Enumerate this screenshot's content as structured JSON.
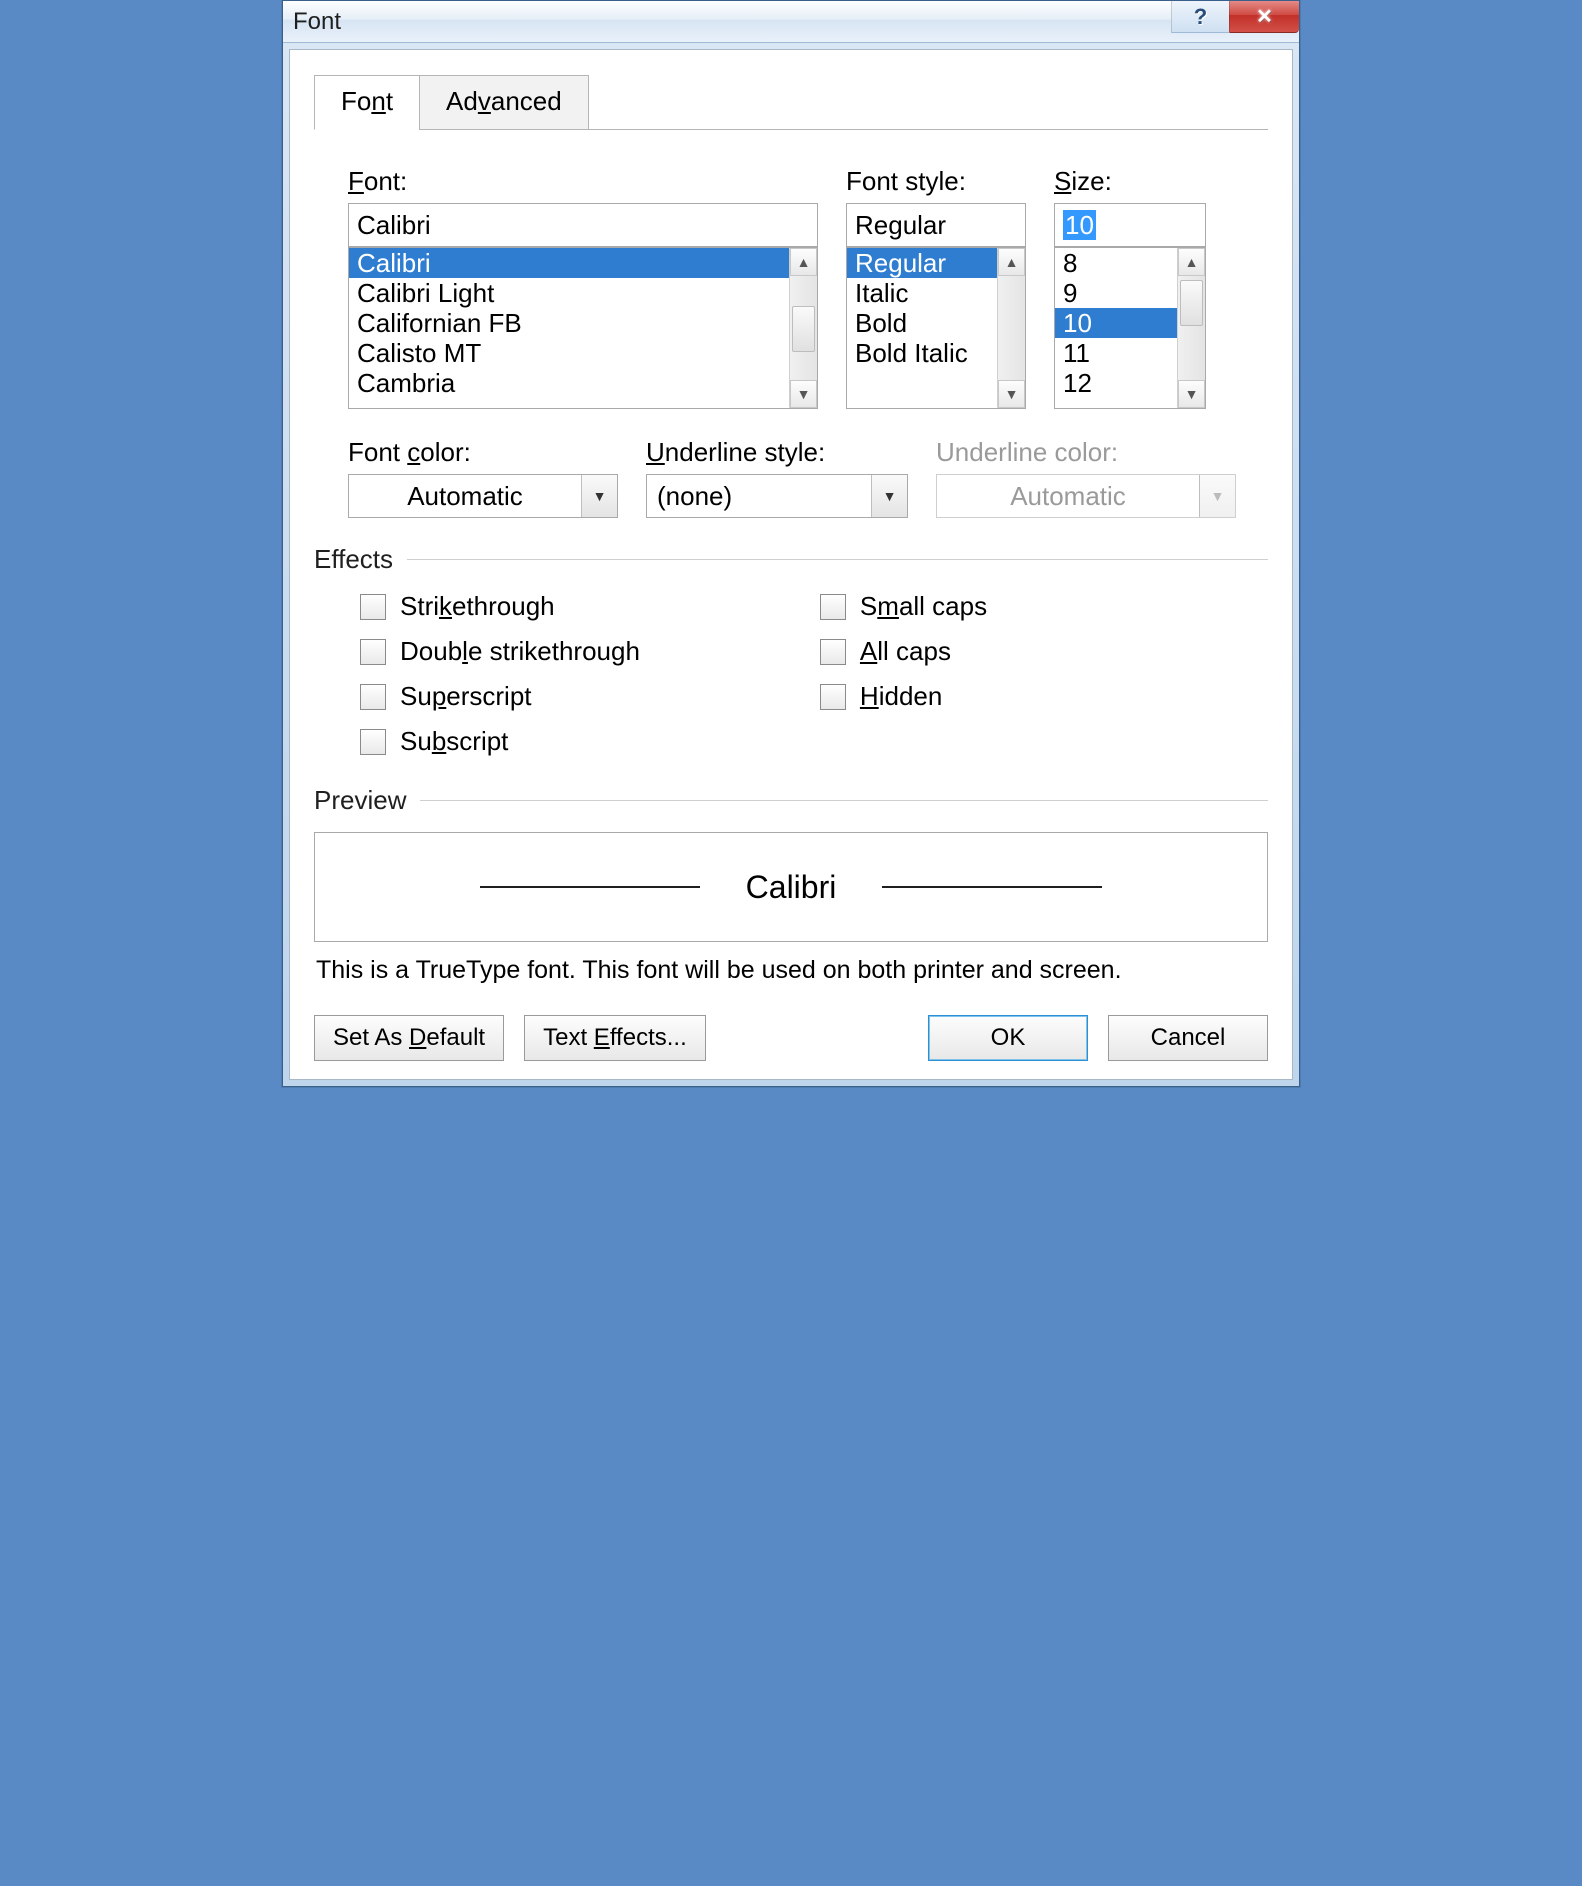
{
  "window": {
    "title": "Font"
  },
  "tabs": {
    "font": "Font",
    "advanced": "Advanced"
  },
  "labels": {
    "font": "Font:",
    "style": "Font style:",
    "size": "Size:",
    "font_color": "Font color:",
    "underline_style": "Underline style:",
    "underline_color": "Underline color:",
    "effects": "Effects",
    "preview": "Preview"
  },
  "font": {
    "value": "Calibri",
    "list": [
      "Calibri",
      "Calibri Light",
      "Californian FB",
      "Calisto MT",
      "Cambria"
    ],
    "selected_index": 0
  },
  "style": {
    "value": "Regular",
    "list": [
      "Regular",
      "Italic",
      "Bold",
      "Bold Italic"
    ],
    "selected_index": 0
  },
  "size": {
    "value": "10",
    "list": [
      "8",
      "9",
      "10",
      "11",
      "12"
    ],
    "selected_index": 2
  },
  "font_color": "Automatic",
  "underline_style": "(none)",
  "underline_color": "Automatic",
  "effects": {
    "strike": "Strikethrough",
    "dstrike": "Double strikethrough",
    "super": "Superscript",
    "sub": "Subscript",
    "smallcaps": "Small caps",
    "allcaps": "All caps",
    "hidden": "Hidden"
  },
  "preview": {
    "sample": "Calibri",
    "note": "This is a TrueType font. This font will be used on both printer and screen."
  },
  "buttons": {
    "set_default": "Set As Default",
    "text_effects": "Text Effects...",
    "ok": "OK",
    "cancel": "Cancel"
  }
}
